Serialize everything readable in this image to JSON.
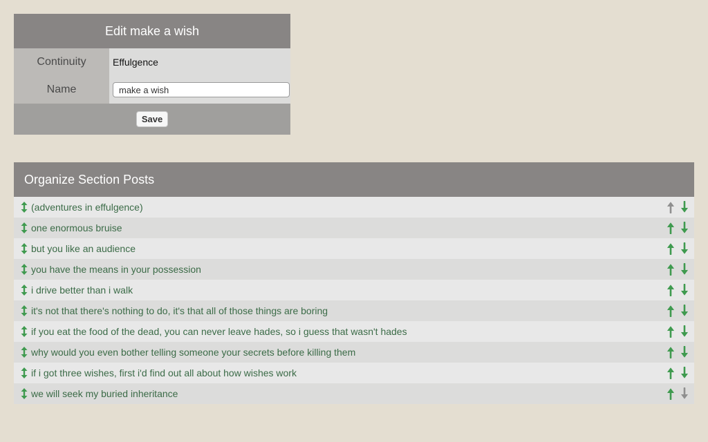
{
  "edit_panel": {
    "title": "Edit make a wish",
    "continuity_label": "Continuity",
    "continuity_value": "Effulgence",
    "name_label": "Name",
    "name_value": "make a wish",
    "save_label": "Save"
  },
  "posts_panel": {
    "title": "Organize Section Posts",
    "posts": [
      {
        "title": "(adventures in effulgence)",
        "can_move_up": false,
        "can_move_down": true
      },
      {
        "title": "one enormous bruise",
        "can_move_up": true,
        "can_move_down": true
      },
      {
        "title": "but you like an audience",
        "can_move_up": true,
        "can_move_down": true
      },
      {
        "title": "you have the means in your possession",
        "can_move_up": true,
        "can_move_down": true
      },
      {
        "title": "i drive better than i walk",
        "can_move_up": true,
        "can_move_down": true
      },
      {
        "title": "it's not that there's nothing to do, it's that all of those things are boring",
        "can_move_up": true,
        "can_move_down": true
      },
      {
        "title": "if you eat the food of the dead, you can never leave hades, so i guess that wasn't hades",
        "can_move_up": true,
        "can_move_down": true
      },
      {
        "title": "why would you even bother telling someone your secrets before killing them",
        "can_move_up": true,
        "can_move_down": true
      },
      {
        "title": "if i got three wishes, first i'd find out all about how wishes work",
        "can_move_up": true,
        "can_move_down": true
      },
      {
        "title": "we will seek my buried inheritance",
        "can_move_up": true,
        "can_move_down": false
      }
    ]
  },
  "icons": {
    "drag": "drag-handle-icon",
    "up": "arrow-up-icon",
    "down": "arrow-down-icon"
  },
  "colors": {
    "background": "#e4ded1",
    "header": "#888584",
    "arrow_enabled": "#3f9a4f",
    "arrow_disabled": "#8f8f8f",
    "post_link": "#3b6b47"
  }
}
